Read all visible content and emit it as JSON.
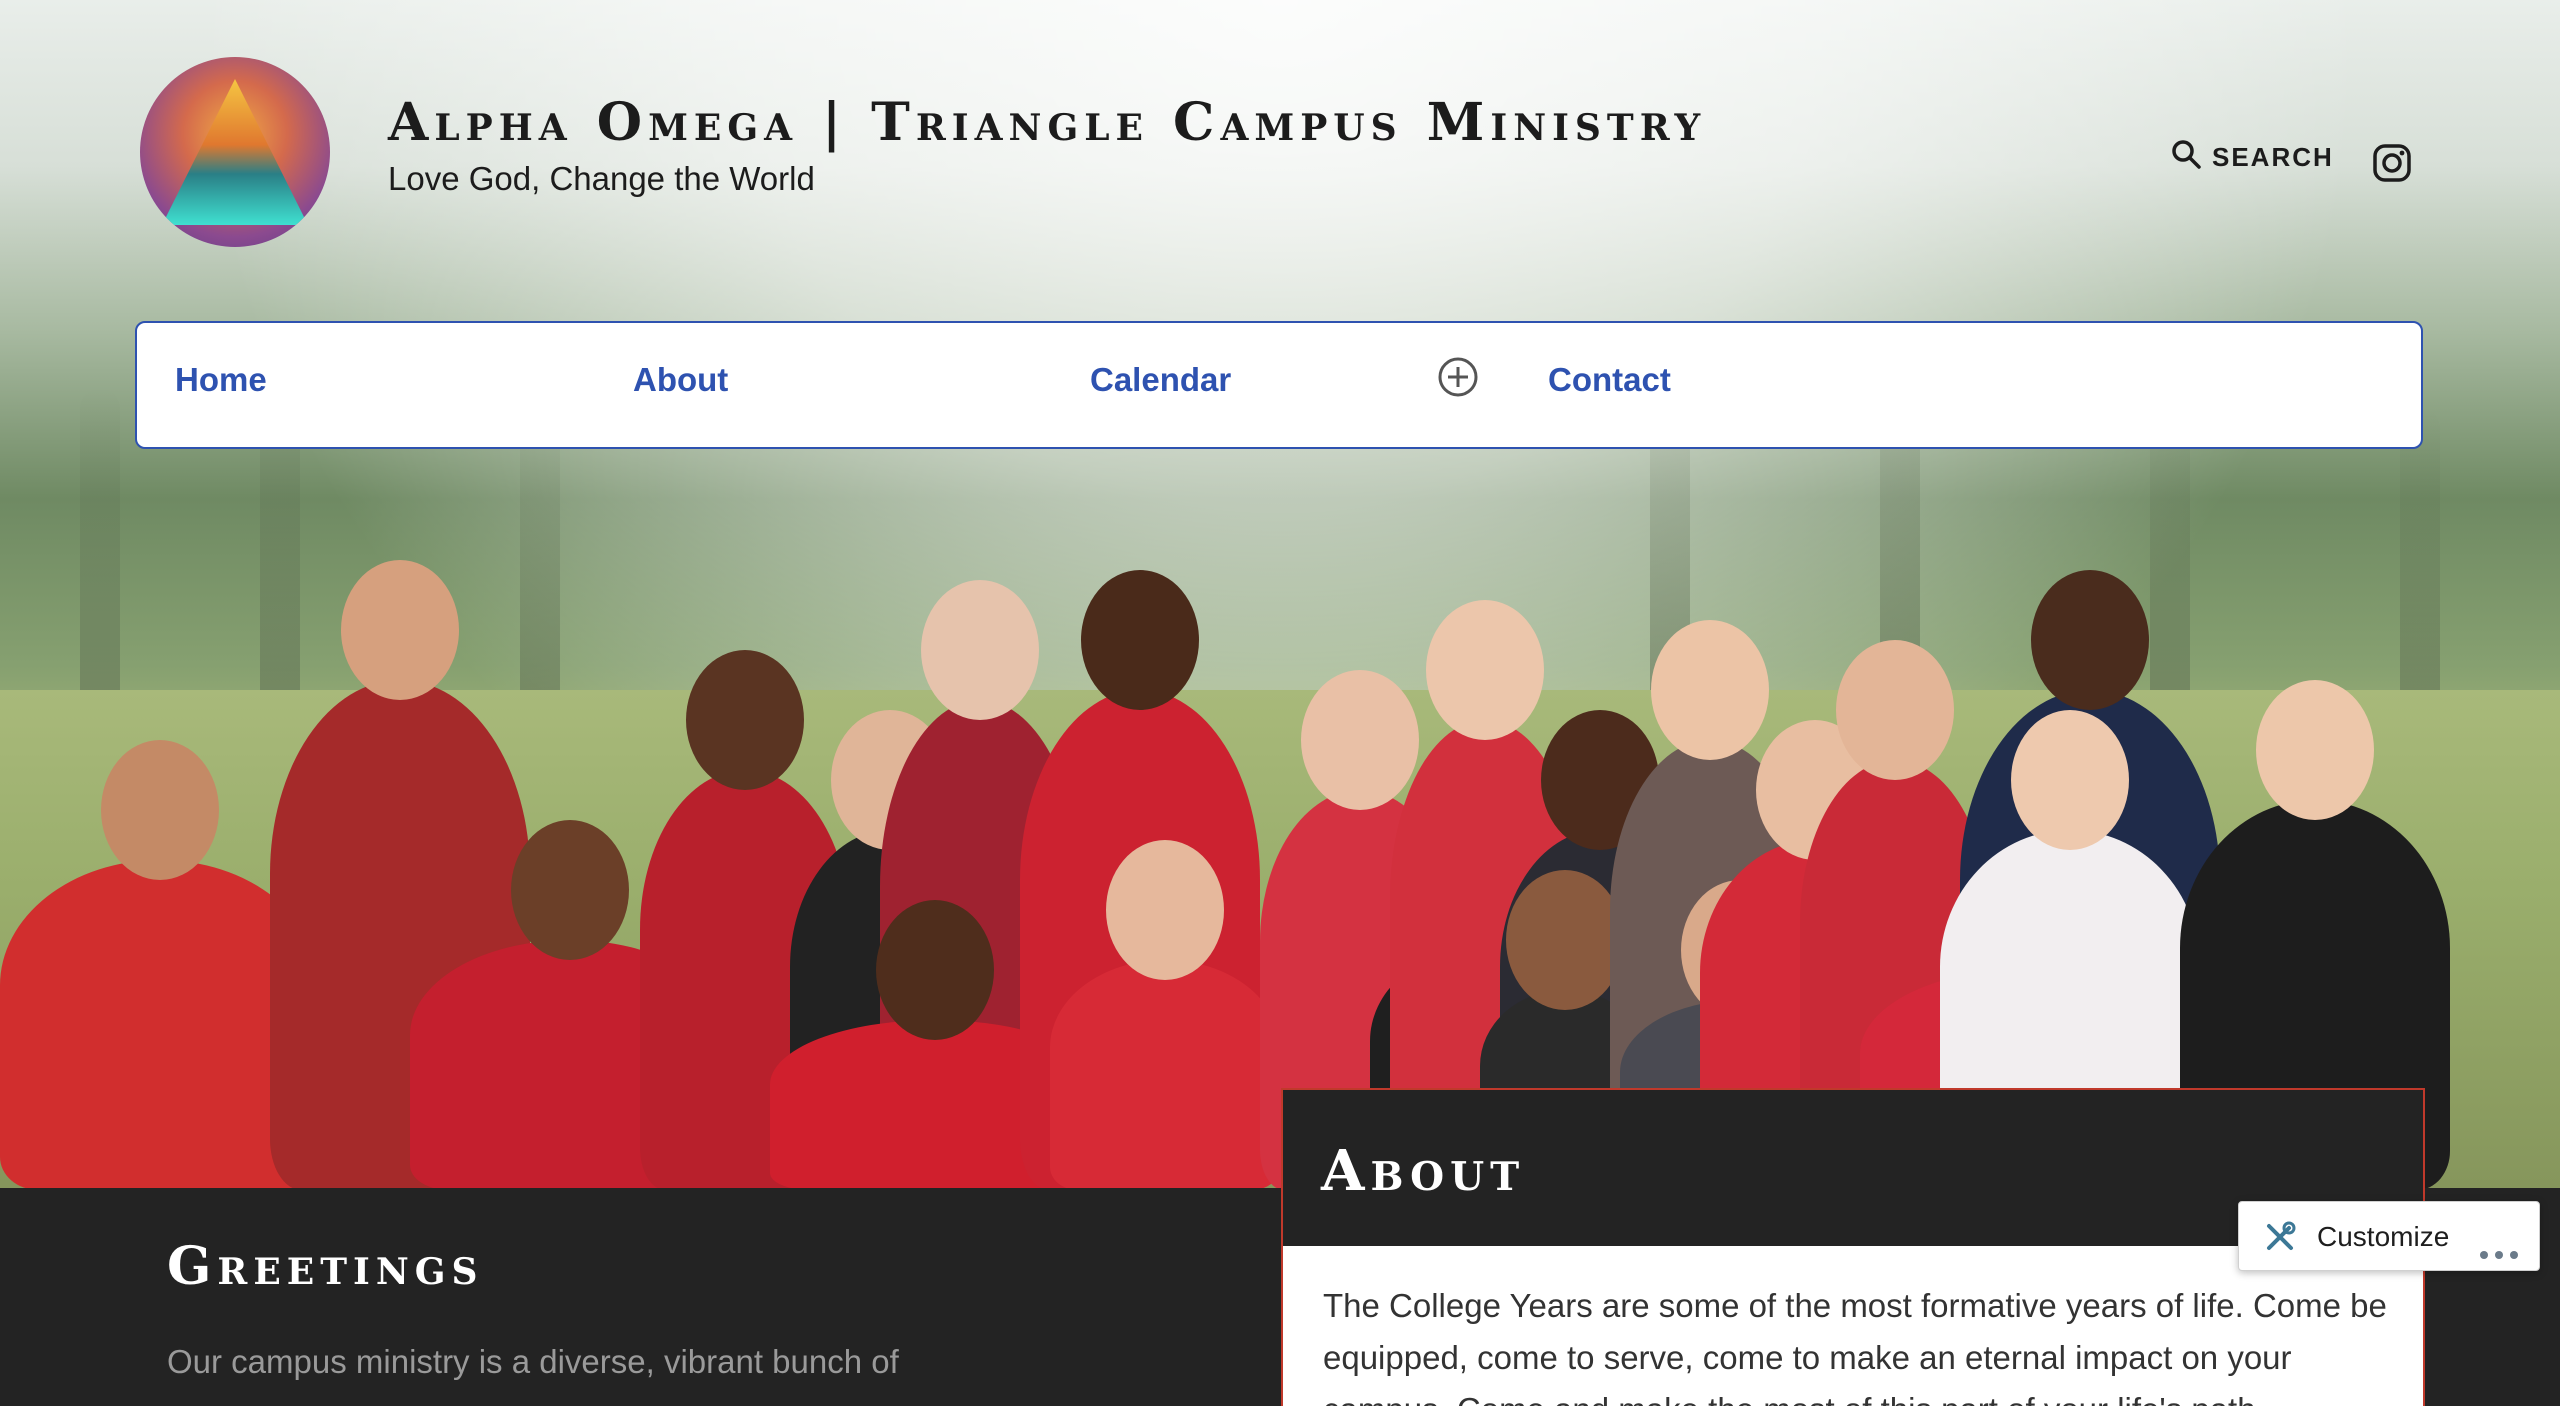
{
  "site": {
    "title": "Alpha Omega | Triangle Campus Ministry",
    "tagline": "Love God, Change the World"
  },
  "header": {
    "search_label": "SEARCH",
    "search_icon": "magnifier",
    "social_icon": "instagram"
  },
  "nav": {
    "items": [
      {
        "label": "Home"
      },
      {
        "label": "About"
      },
      {
        "label": "Calendar"
      },
      {
        "label": "Contact"
      }
    ],
    "submenu_toggle_icon": "circled-plus"
  },
  "hero": {
    "image_alt": "Group photo of students in red shirts making hand signs in a park"
  },
  "sections": {
    "greetings": {
      "title": "Greetings",
      "text": "Our campus ministry is a diverse, vibrant bunch of"
    },
    "about": {
      "title": "About",
      "text": "The College Years are some of the most formative years of life. Come be equipped, come to serve, come to make an eternal impact on your campus. Come and make the most of this part of your life's path."
    }
  },
  "customize_bar": {
    "label": "Customize",
    "icon": "tools",
    "more_icon": "ellipsis"
  },
  "colors": {
    "nav_accent": "#2e52b0",
    "dark_bg": "#232323",
    "card_border": "#c0392b"
  }
}
